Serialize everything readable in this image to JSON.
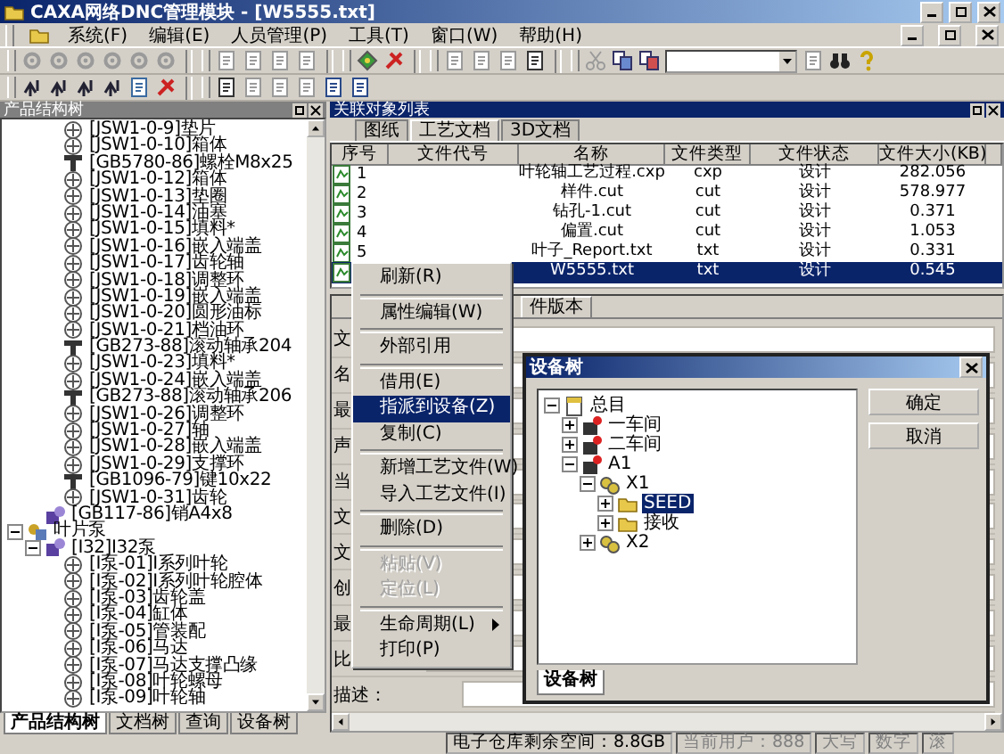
{
  "window": {
    "title": "CAXA网络DNC管理模块 - [W5555.txt]"
  },
  "menu": [
    "系统(F)",
    "编辑(E)",
    "人员管理(P)",
    "工具(T)",
    "窗口(W)",
    "帮助(H)"
  ],
  "left_panel": {
    "title": "产品结构树",
    "tree": [
      {
        "children": [
          {
            "children": [
              {
                "label": "[JSW1-0-9]垫片",
                "kind": "part"
              },
              {
                "label": "[JSW1-0-10]箱体",
                "kind": "part"
              },
              {
                "label": "[GB5780-86]螺栓M8x25",
                "kind": "standard"
              },
              {
                "label": "[JSW1-0-12]箱体",
                "kind": "part"
              },
              {
                "label": "[JSW1-0-13]垫圈",
                "kind": "part"
              },
              {
                "label": "[JSW1-0-14]油塞",
                "kind": "part"
              },
              {
                "label": "[JSW1-0-15]填料*",
                "kind": "part"
              },
              {
                "label": "[JSW1-0-16]嵌入端盖",
                "kind": "part"
              },
              {
                "label": "[JSW1-0-17]齿轮轴",
                "kind": "part"
              },
              {
                "label": "[JSW1-0-18]调整环",
                "kind": "part"
              },
              {
                "label": "[JSW1-0-19]嵌入端盖",
                "kind": "part"
              },
              {
                "label": "[JSW1-0-20]圆形油标",
                "kind": "part"
              },
              {
                "label": "[JSW1-0-21]档油环",
                "kind": "part"
              },
              {
                "label": "[GB273-88]滚动轴承204",
                "kind": "standard"
              },
              {
                "label": "[JSW1-0-23]填料*",
                "kind": "part"
              },
              {
                "label": "[JSW1-0-24]嵌入端盖",
                "kind": "part"
              },
              {
                "label": "[GB273-88]滚动轴承206",
                "kind": "standard"
              },
              {
                "label": "[JSW1-0-26]调整环",
                "kind": "part"
              },
              {
                "label": "[JSW1-0-27]轴",
                "kind": "part"
              },
              {
                "label": "[JSW1-0-28]嵌入端盖",
                "kind": "part"
              },
              {
                "label": "[JSW1-0-29]支撑环",
                "kind": "part"
              },
              {
                "label": "[GB1096-79]键10x22",
                "kind": "standard"
              },
              {
                "label": "[JSW1-0-31]齿轮",
                "kind": "part"
              }
            ]
          },
          {
            "label": "[GB117-86]销A4x8",
            "kind": "assembly"
          }
        ]
      },
      {
        "label": "叶片泵",
        "kind": "group",
        "expanded": true,
        "children": [
          {
            "label": "[I32]I32泵",
            "kind": "assembly",
            "expanded": true,
            "children": [
              {
                "label": "[I泵-01]I系列叶轮",
                "kind": "part"
              },
              {
                "label": "[I泵-02]I系列叶轮腔体",
                "kind": "part"
              },
              {
                "label": "[I泵-03]齿轮盖",
                "kind": "part"
              },
              {
                "label": "[I泵-04]缸体",
                "kind": "part"
              },
              {
                "label": "[I泵-05]管装配",
                "kind": "part"
              },
              {
                "label": "[I泵-06]马达",
                "kind": "part"
              },
              {
                "label": "[I泵-07]马达支撑凸缘",
                "kind": "part"
              },
              {
                "label": "[I泵-08]叶轮螺母",
                "kind": "part"
              },
              {
                "label": "[I泵-09]叶轮轴",
                "kind": "part"
              }
            ]
          }
        ]
      }
    ],
    "tabs": [
      {
        "label": "产品结构树",
        "selected": true
      },
      {
        "label": "文档树",
        "selected": false
      },
      {
        "label": "查询",
        "selected": false
      },
      {
        "label": "设备树",
        "selected": false
      }
    ]
  },
  "right_panel": {
    "title": "关联对象列表",
    "tabs": [
      {
        "label": "图纸",
        "selected": false
      },
      {
        "label": "工艺文档",
        "selected": true
      },
      {
        "label": "3D文档",
        "selected": false
      }
    ],
    "table": {
      "columns": [
        "序号",
        "文件代号",
        "名称",
        "文件类型",
        "文件状态",
        "文件大小(KB)"
      ],
      "rows": [
        {
          "number": "1",
          "name": "叶轮轴工艺过程.cxp",
          "type": "cxp",
          "status": "设计",
          "size": "282.056",
          "selected": false
        },
        {
          "number": "2",
          "name": "样件.cut",
          "type": "cut",
          "status": "设计",
          "size": "578.977",
          "selected": false
        },
        {
          "number": "3",
          "name": "钻孔-1.cut",
          "type": "cut",
          "status": "设计",
          "size": "0.371",
          "selected": false
        },
        {
          "number": "4",
          "name": "偏置.cut",
          "type": "cut",
          "status": "设计",
          "size": "1.053",
          "selected": false
        },
        {
          "number": "5",
          "name": "叶子_Report.txt",
          "type": "txt",
          "status": "设计",
          "size": "0.331",
          "selected": false
        },
        {
          "name": "W5555.txt",
          "type": "txt",
          "status": "设计",
          "size": "0.545",
          "selected": true
        }
      ]
    },
    "properties": {
      "tabs": [
        {
          "label": "件版本",
          "selected": true
        }
      ],
      "labels": [
        "文",
        "名",
        "最",
        "声",
        "当",
        "文",
        "文",
        "创",
        "最",
        "比",
        "描述："
      ]
    }
  },
  "context_menu": {
    "items": [
      {
        "kind": "item",
        "label": "刷新(R)",
        "selected": false,
        "disabled": false
      },
      {
        "kind": "separator"
      },
      {
        "kind": "item",
        "label": "属性编辑(W)",
        "selected": false,
        "disabled": false
      },
      {
        "kind": "separator"
      },
      {
        "kind": "item",
        "label": "外部引用",
        "selected": false,
        "disabled": false
      },
      {
        "kind": "separator"
      },
      {
        "kind": "item",
        "label": "借用(E)",
        "selected": false,
        "disabled": false
      },
      {
        "kind": "item",
        "label": "指派到设备(Z)",
        "selected": true,
        "disabled": false
      },
      {
        "kind": "item",
        "label": "复制(C)",
        "selected": false,
        "disabled": false
      },
      {
        "kind": "separator"
      },
      {
        "kind": "item",
        "label": "新增工艺文件(W)",
        "selected": false,
        "disabled": false
      },
      {
        "kind": "item",
        "label": "导入工艺文件(I)",
        "selected": false,
        "disabled": false
      },
      {
        "kind": "separator"
      },
      {
        "kind": "item",
        "label": "删除(D)",
        "selected": false,
        "disabled": false
      },
      {
        "kind": "separator"
      },
      {
        "kind": "item",
        "label": "粘贴(V)",
        "selected": false,
        "disabled": true
      },
      {
        "kind": "item",
        "label": "定位(L)",
        "selected": false,
        "disabled": true
      },
      {
        "kind": "separator"
      },
      {
        "kind": "submenu",
        "label": "生命周期(L)",
        "selected": false,
        "disabled": false
      },
      {
        "kind": "item",
        "label": "打印(P)",
        "selected": false,
        "disabled": false
      }
    ]
  },
  "dialog": {
    "title": "设备树",
    "tree": [
      {
        "label": "总目",
        "kind": "root",
        "expanded": true,
        "selected": false,
        "children": [
          {
            "label": "一车间",
            "kind": "workshop",
            "expanded": false,
            "selected": false
          },
          {
            "label": "二车间",
            "kind": "workshop",
            "expanded": false,
            "selected": false
          },
          {
            "label": "A1",
            "kind": "workshop",
            "expanded": true,
            "selected": false,
            "children": [
              {
                "label": "X1",
                "kind": "machine",
                "expanded": true,
                "selected": false,
                "children": [
                  {
                    "label": "SEED",
                    "kind": "folder",
                    "expanded": false,
                    "selected": true
                  },
                  {
                    "label": "接收",
                    "kind": "folder",
                    "expanded": false,
                    "selected": false
                  }
                ]
              },
              {
                "label": "X2",
                "kind": "machine",
                "expanded": false,
                "selected": false
              }
            ]
          }
        ]
      }
    ],
    "buttons": [
      "确定",
      "取消"
    ],
    "tabs": [
      {
        "label": "设备树",
        "selected": true
      }
    ]
  },
  "status_bar": [
    "电子仓库剩余空间：8.8GB",
    "当前用户：888",
    "大写",
    "数字",
    "滚"
  ]
}
